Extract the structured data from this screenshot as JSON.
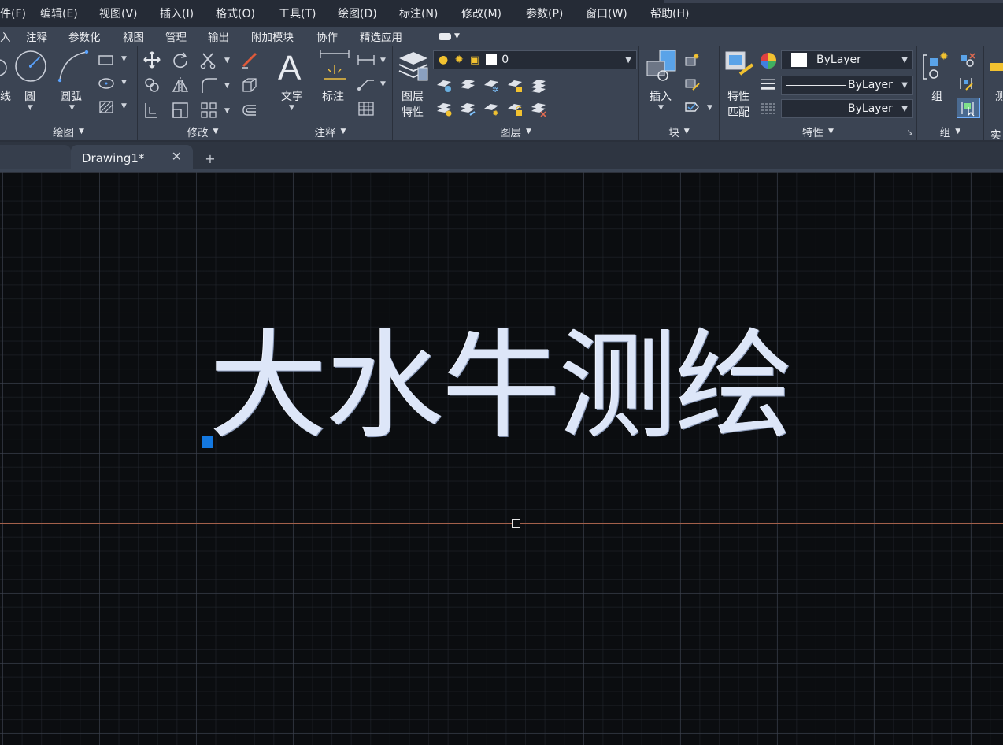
{
  "menu": [
    "件(F)",
    "编辑(E)",
    "视图(V)",
    "插入(I)",
    "格式(O)",
    "工具(T)",
    "绘图(D)",
    "标注(N)",
    "修改(M)",
    "参数(P)",
    "窗口(W)",
    "帮助(H)"
  ],
  "ribbon_tabs": [
    "入",
    "注释",
    "参数化",
    "视图",
    "管理",
    "输出",
    "附加模块",
    "协作",
    "精选应用"
  ],
  "panels": {
    "draw": {
      "title": "绘图",
      "line_label": "线",
      "circle_label": "圆",
      "arc_label": "圆弧"
    },
    "modify": {
      "title": "修改"
    },
    "annotation": {
      "title": "注释",
      "text_label": "文字",
      "dim_label": "标注"
    },
    "layers": {
      "title": "图层",
      "layer_props_line1": "图层",
      "layer_props_line2": "特性",
      "current_layer": "0"
    },
    "block": {
      "title": "块",
      "insert_label": "插入"
    },
    "properties": {
      "title": "特性",
      "match_line1": "特性",
      "match_line2": "匹配",
      "color": "ByLayer",
      "linetype": "ByLayer",
      "lineweight": "ByLayer"
    },
    "group": {
      "title": "组",
      "group_label": "组"
    },
    "util": {
      "title": "实",
      "label": "测"
    }
  },
  "document_tab": "Drawing1*",
  "drawing_text": "大水牛测绘",
  "colors": {
    "menubar": "#252b36",
    "ribbon": "#3b4453",
    "canvas": "#0b0d10",
    "grip": "#1478e0",
    "y_axis": "#7f9a6c",
    "x_axis": "#a3604a"
  }
}
